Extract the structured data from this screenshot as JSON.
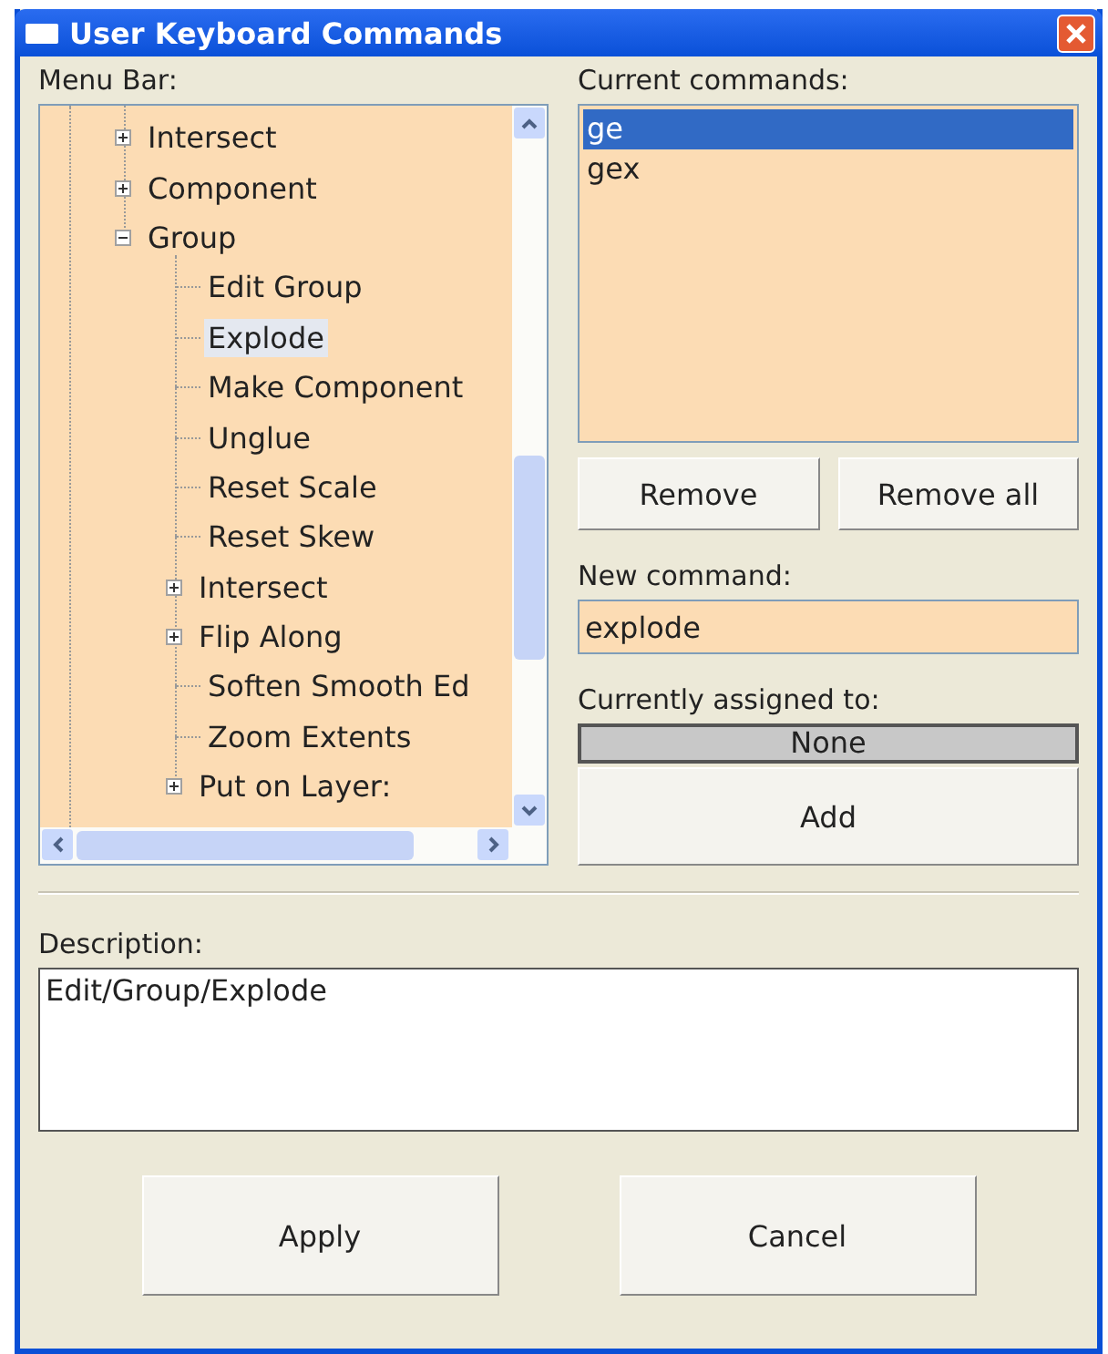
{
  "window": {
    "title": "User Keyboard Commands"
  },
  "menu_bar": {
    "label": "Menu Bar:",
    "tree": [
      {
        "label": "Intersect",
        "kind": "branch",
        "expanded": false,
        "selected": false
      },
      {
        "label": "Component",
        "kind": "branch",
        "expanded": false,
        "selected": false
      },
      {
        "label": "Group",
        "kind": "branch",
        "expanded": true,
        "selected": false,
        "children": [
          {
            "label": "Edit Group",
            "kind": "leaf",
            "selected": false
          },
          {
            "label": "Explode",
            "kind": "leaf",
            "selected": true
          },
          {
            "label": "Make Component",
            "kind": "leaf",
            "selected": false
          },
          {
            "label": "Unglue",
            "kind": "leaf",
            "selected": false
          },
          {
            "label": "Reset Scale",
            "kind": "leaf",
            "selected": false
          },
          {
            "label": "Reset Skew",
            "kind": "leaf",
            "selected": false
          },
          {
            "label": "Intersect",
            "kind": "branch",
            "expanded": false,
            "selected": false
          },
          {
            "label": "Flip Along",
            "kind": "branch",
            "expanded": false,
            "selected": false
          },
          {
            "label": "Soften Smooth Ed",
            "kind": "leaf",
            "selected": false
          },
          {
            "label": "Zoom Extents",
            "kind": "leaf",
            "selected": false
          },
          {
            "label": "Put on Layer:",
            "kind": "branch",
            "expanded": false,
            "selected": false
          }
        ]
      }
    ]
  },
  "current_commands": {
    "label": "Current commands:",
    "items": [
      {
        "text": "ge",
        "selected": true
      },
      {
        "text": "gex",
        "selected": false
      }
    ]
  },
  "command_buttons": [
    "Remove",
    "Remove all"
  ],
  "new_command": {
    "label": "New command:",
    "value": "explode"
  },
  "assigned": {
    "label": "Currently assigned to:",
    "value": "None"
  },
  "add_button": "Add",
  "description": {
    "label": "Description:",
    "value": "Edit/Group/Explode"
  },
  "buttons": [
    "Apply",
    "Cancel"
  ]
}
